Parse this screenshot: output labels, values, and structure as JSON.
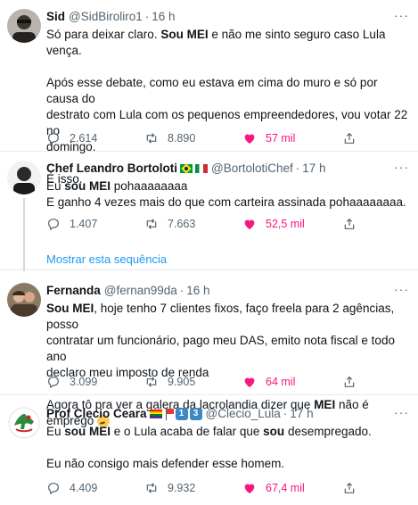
{
  "tweets": [
    {
      "name": "Sid",
      "handle": "@SidBiroliro1",
      "sep": "·",
      "time": "16 h",
      "lines": [
        [
          "Só para deixar claro. ",
          "Sou MEI",
          " e não me sinto seguro caso Lula vença."
        ],
        "Após esse debate, como eu estava em cima do muro e só por causa do",
        "destrato com Lula com os pequenos empreendedores, vou votar 22 no",
        "domingo.",
        "É isso."
      ],
      "replies": "2.614",
      "retweets": "8.890",
      "likes": "57 mil"
    },
    {
      "name": "Chef Leandro Bortoloti",
      "handle": "@BortolotiChef",
      "sep": "·",
      "time": "17 h",
      "lines": [
        [
          "Eu ",
          "sou MEI",
          " pohaaaaaaaa"
        ],
        "E ganho 4 vezes mais do que com carteira assinada pohaaaaaaaa."
      ],
      "replies": "1.407",
      "retweets": "7.663",
      "likes": "52,5 mil",
      "show_thread": "Mostrar esta sequência"
    },
    {
      "name": "Fernanda",
      "handle": "@fernan99da",
      "sep": "·",
      "time": "16 h",
      "lines": [
        [
          "",
          "Sou MEI",
          ", hoje tenho 7 clientes fixos, faço freela para 2 agências, posso"
        ],
        "contratar um funcionário, pago meu DAS, emito nota fiscal e todo ano",
        "declaro meu imposto de renda",
        [
          "Agora tô pra ver a galera da lacrolandia dizer que ",
          "MEI",
          " não é emprego"
        ]
      ],
      "replies": "3.099",
      "retweets": "9.905",
      "likes": "64 mil"
    },
    {
      "name": "Prof Clecio Ceara",
      "handle": "@Clecio_Lula",
      "sep": "·",
      "time": "17 h",
      "keycaps": [
        "1",
        "3"
      ],
      "lines": [
        [
          "Eu ",
          "sou MEI",
          " e o Lula acaba de falar que ",
          "sou",
          " desempregado."
        ],
        "Eu não consigo mais defender esse homem."
      ],
      "replies": "4.409",
      "retweets": "9.932",
      "likes": "67,4 mil"
    }
  ],
  "icons": {
    "reply": "reply-icon",
    "retweet": "retweet-icon",
    "like": "heart-icon",
    "share": "share-icon",
    "more": "more-icon"
  },
  "colors": {
    "like": "#f91880",
    "link": "#1d9bf0",
    "muted": "#536471"
  }
}
